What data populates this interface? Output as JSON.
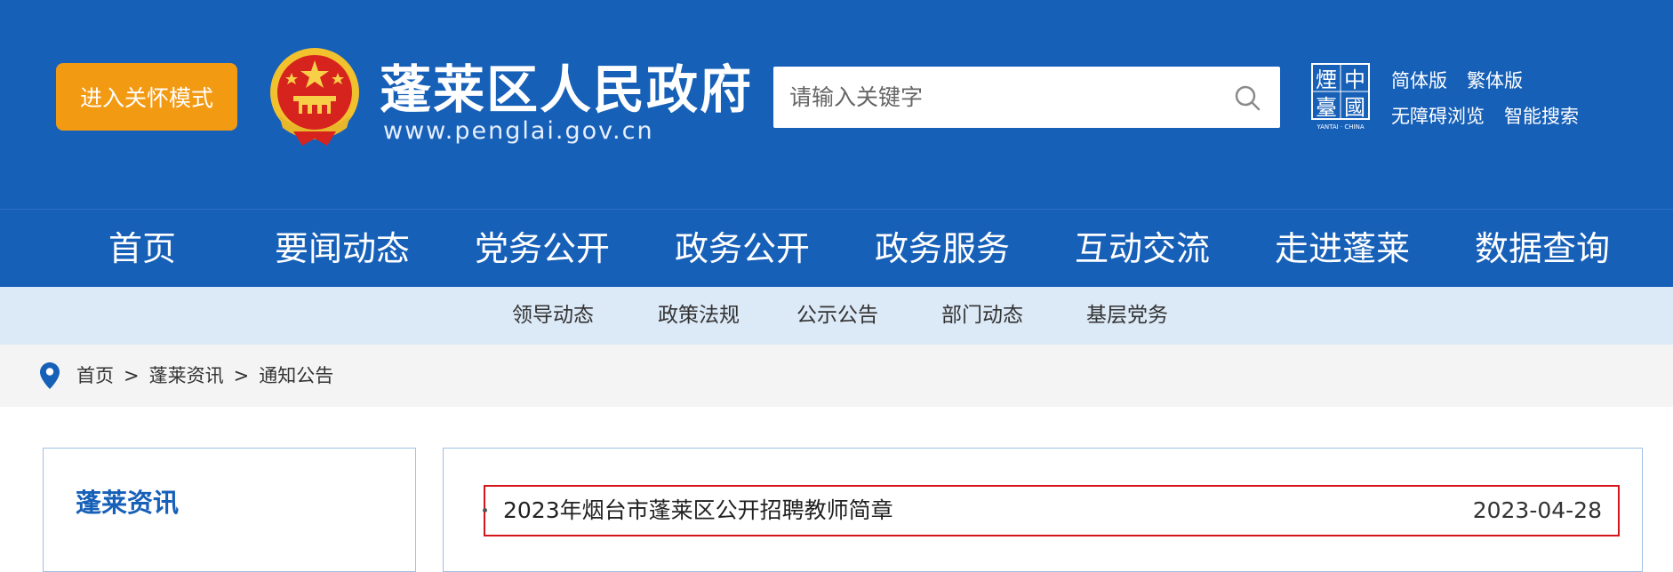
{
  "header": {
    "care_mode_button": "进入关怀模式",
    "site_name": "蓬莱区人民政府",
    "site_url": "www.penglai.gov.cn",
    "logo_caption": "YANTAI · CHINA",
    "logo_glyphs": [
      "煙",
      "中",
      "臺",
      "國"
    ],
    "colors": {
      "brand_blue": "#1760b8",
      "care_orange": "#f39a13",
      "highlight_red": "#d4151b"
    }
  },
  "search": {
    "placeholder": "请输入关键字"
  },
  "toplinks": {
    "simplified": "简体版",
    "traditional": "繁体版",
    "accessibility": "无障碍浏览",
    "smart_search": "智能搜索"
  },
  "nav": {
    "items": [
      {
        "label": "首页"
      },
      {
        "label": "要闻动态"
      },
      {
        "label": "党务公开"
      },
      {
        "label": "政务公开"
      },
      {
        "label": "政务服务"
      },
      {
        "label": "互动交流"
      },
      {
        "label": "走进蓬莱"
      },
      {
        "label": "数据查询"
      }
    ]
  },
  "subnav": {
    "items": [
      {
        "label": "领导动态"
      },
      {
        "label": "政策法规"
      },
      {
        "label": "公示公告"
      },
      {
        "label": "部门动态"
      },
      {
        "label": "基层党务"
      }
    ]
  },
  "breadcrumb": {
    "items": [
      {
        "label": "首页"
      },
      {
        "label": "蓬莱资讯"
      },
      {
        "label": "通知公告"
      }
    ],
    "separator": ">"
  },
  "sidebar": {
    "title": "蓬莱资讯"
  },
  "articles": [
    {
      "title": "2023年烟台市蓬莱区公开招聘教师简章",
      "date": "2023-04-28"
    }
  ]
}
